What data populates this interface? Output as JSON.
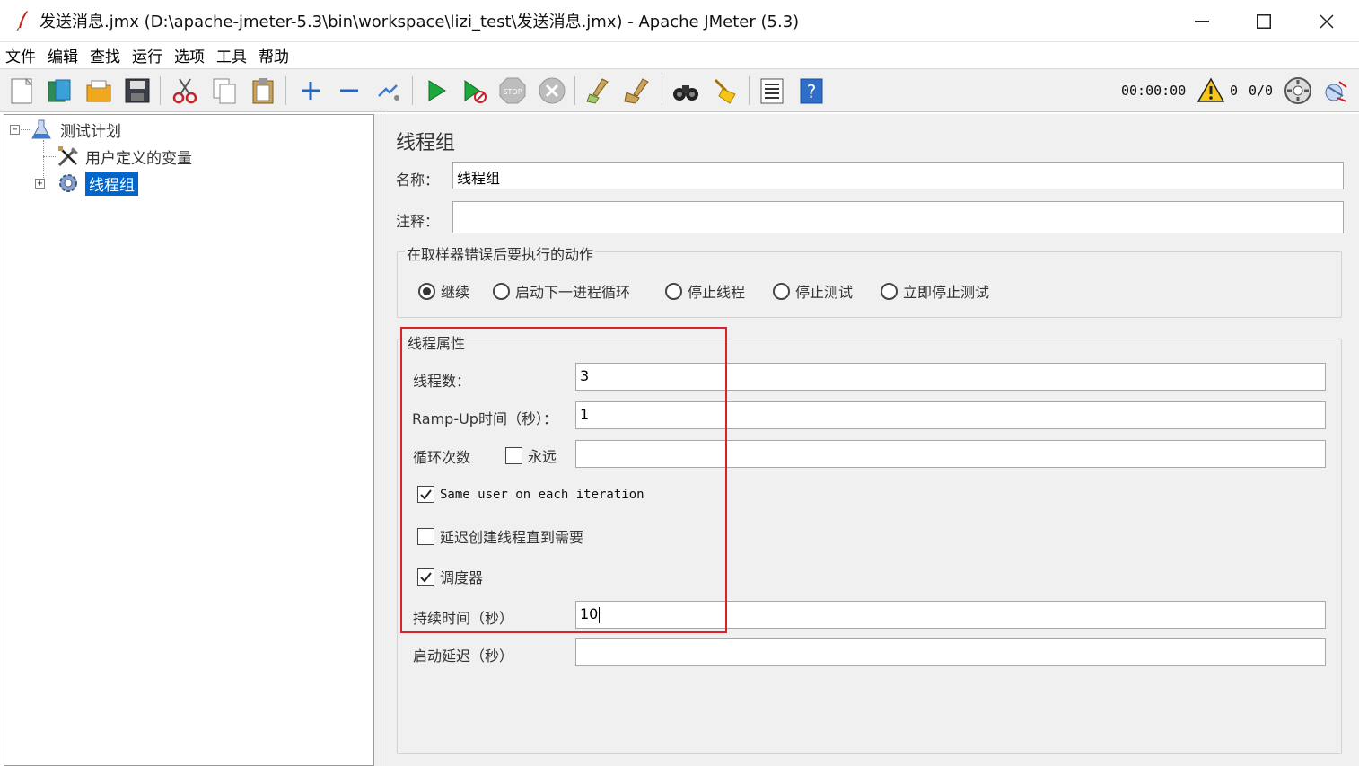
{
  "window": {
    "title": "发送消息.jmx (D:\\apache-jmeter-5.3\\bin\\workspace\\lizi_test\\发送消息.jmx) - Apache JMeter (5.3)",
    "minimize": "—",
    "maximize": "☐",
    "close": "✕"
  },
  "menu": {
    "items": [
      "文件",
      "编辑",
      "查找",
      "运行",
      "选项",
      "工具",
      "帮助"
    ]
  },
  "toolbar": {
    "timer": "00:00:00",
    "warning_count": "0",
    "threads": "0/0"
  },
  "tree": {
    "items": [
      {
        "label": "测试计划",
        "expander": "−"
      },
      {
        "label": "用户定义的变量"
      },
      {
        "label": "线程组",
        "expander": "+"
      }
    ]
  },
  "panel": {
    "title": "线程组",
    "name_label": "名称：",
    "name_value": "线程组",
    "comment_label": "注释：",
    "comment_value": "",
    "error_action": {
      "title": "在取样器错误后要执行的动作",
      "options": [
        "继续",
        "启动下一进程循环",
        "停止线程",
        "停止测试",
        "立即停止测试"
      ],
      "selected": 0
    },
    "thread_props": {
      "title": "线程属性",
      "threads_label": "线程数：",
      "threads_value": "3",
      "rampup_label": "Ramp-Up时间（秒）：",
      "rampup_value": "1",
      "loop_label": "循环次数",
      "forever_label": "永远",
      "loop_value": "",
      "same_user_label": "Same user on each iteration",
      "delay_create_label": "延迟创建线程直到需要",
      "scheduler_label": "调度器",
      "duration_label": "持续时间（秒）",
      "duration_value": "10",
      "startup_delay_label": "启动延迟（秒）",
      "startup_delay_value": ""
    }
  },
  "colors": {
    "selection": "#0066cc",
    "highlight_box": "#d9222a",
    "panel_bg": "#f0f0f0"
  }
}
